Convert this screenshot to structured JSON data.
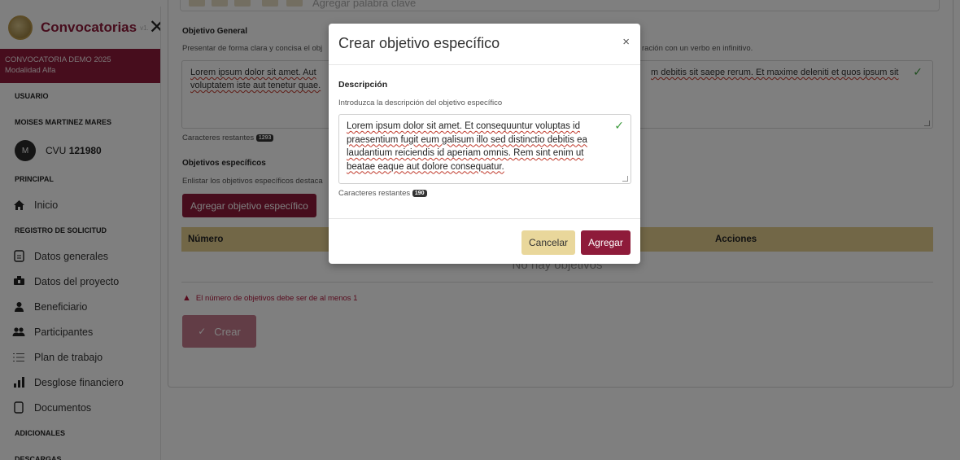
{
  "sidebar": {
    "title": "Convocatorias",
    "version": "v1.",
    "convocatoria_name": "CONVOCATORIA DEMO 2025",
    "modality": "Modalidad Alfa",
    "section_user": "USUARIO",
    "user_name": "MOISES MARTINEZ MARES",
    "avatar_initial": "M",
    "cvu_label": "CVU",
    "cvu_number": "121980",
    "section_principal": "PRINCIPAL",
    "inicio": "Inicio",
    "section_registro": "REGISTRO DE SOLICITUD",
    "items": [
      {
        "label": "Datos generales",
        "icon": "document-icon"
      },
      {
        "label": "Datos del proyecto",
        "icon": "project-icon"
      },
      {
        "label": "Beneficiario",
        "icon": "user-icon"
      },
      {
        "label": "Participantes",
        "icon": "users-icon"
      },
      {
        "label": "Plan de trabajo",
        "icon": "list-icon"
      },
      {
        "label": "Desglose financiero",
        "icon": "bar-chart-icon"
      },
      {
        "label": "Documentos",
        "icon": "file-icon"
      }
    ],
    "section_adicionales": "ADICIONALES",
    "section_descargas": "DESCARGAS"
  },
  "main": {
    "keywords_placeholder": "Agregar palabra clave",
    "objetivo_general_label": "Objetivo General",
    "objetivo_general_help": "Presentar de forma clara y concisa el obj",
    "objetivo_general_help_end": "ración con un verbo en infinitivo.",
    "objetivo_general_text_start": "Lorem ipsum dolor sit amet. Aut",
    "objetivo_general_text_line2": "voluptatem iste aut tenetur quae.",
    "objetivo_general_text_end": "m debitis sit saepe rerum. Et maxime deleniti et quos ipsum sit",
    "caracteres_label": "Caracteres restantes",
    "caracteres_general": "1293",
    "especificos_label": "Objetivos específicos",
    "especificos_help": "Enlistar los objetivos específicos destaca",
    "add_button": "Agregar objetivo específico",
    "col_numero": "Número",
    "col_acciones": "Acciones",
    "empty_text": "No hay objetivos",
    "error_text": "El número de objetivos debe ser de al menos 1",
    "crear_button": "Crear"
  },
  "modal": {
    "title": "Crear objetivo específico",
    "close": "×",
    "descripcion_label": "Descripción",
    "descripcion_help": "Introduzca la descripción del objetivo específico",
    "descripcion_value": "Lorem ipsum dolor sit amet. Et consequuntur voluptas id praesentium fugit eum galisum illo sed distinctio debitis ea laudantium reiciendis id aperiam omnis. Rem sint enim ut beatae eaque aut dolore consequatur.",
    "caracteres_label": "Caracteres restantes",
    "caracteres_value": "190",
    "cancel_button": "Cancelar",
    "save_button": "Agregar"
  },
  "colors": {
    "brand": "#8e1b3a",
    "accent_gold": "#e4cf8f",
    "success": "#3c9a3c"
  }
}
